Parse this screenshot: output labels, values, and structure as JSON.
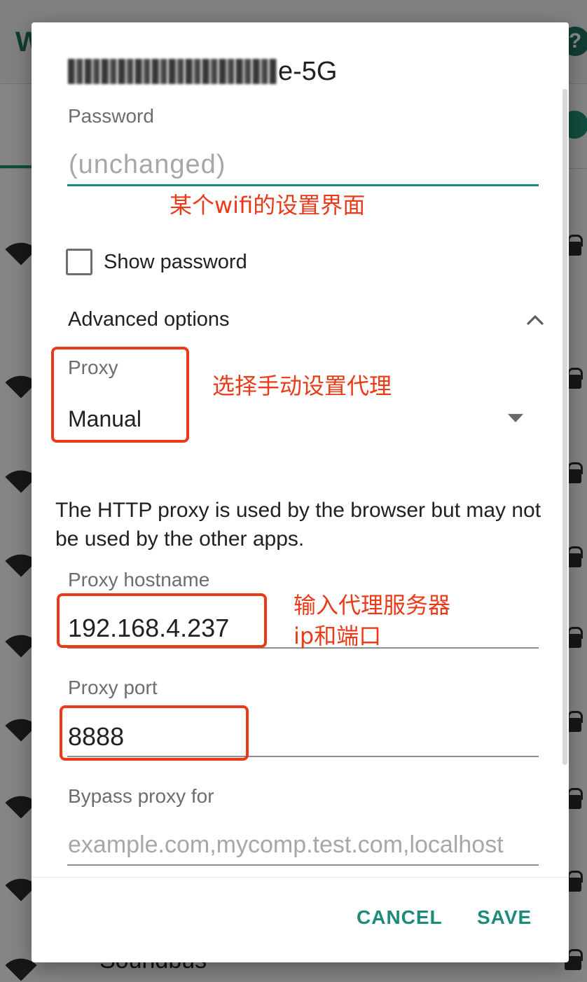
{
  "background": {
    "title_fragment": "W",
    "help_glyph": "?",
    "network_name": "Soundbus"
  },
  "dialog": {
    "ssid_visible_suffix": "e-5G",
    "password": {
      "label": "Password",
      "placeholder": "(unchanged)"
    },
    "show_password": {
      "label": "Show password",
      "checked": false
    },
    "advanced_options": {
      "label": "Advanced options",
      "expanded": true
    },
    "proxy": {
      "label": "Proxy",
      "value": "Manual"
    },
    "proxy_info": "The HTTP proxy is used by the browser but may not be used by the other apps.",
    "proxy_hostname": {
      "label": "Proxy hostname",
      "value": "192.168.4.237"
    },
    "proxy_port": {
      "label": "Proxy port",
      "value": "8888"
    },
    "bypass": {
      "label": "Bypass proxy for",
      "placeholder": "example.com,mycomp.test.com,localhost"
    },
    "buttons": {
      "cancel": "CANCEL",
      "save": "SAVE"
    }
  },
  "annotations": {
    "wifi_settings": "某个wifi的设置界面",
    "choose_manual": "选择手动设置代理",
    "enter_proxy_line1": "输入代理服务器",
    "enter_proxy_line2": "ip和端口"
  },
  "colors": {
    "accent": "#1d8a7a",
    "annotation": "#ea3a18"
  }
}
